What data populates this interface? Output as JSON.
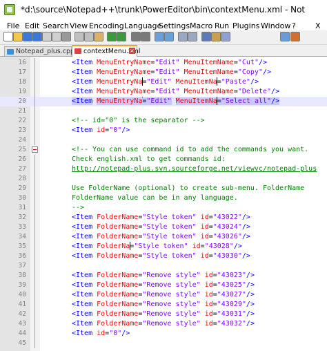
{
  "window": {
    "title": "*d:\\source\\Notepad++\\trunk\\PowerEditor\\bin\\contextMenu.xml - Not"
  },
  "menu": {
    "items": [
      "File",
      "Edit",
      "Search",
      "View",
      "Encoding",
      "Language",
      "Settings",
      "Macro",
      "Run",
      "Plugins",
      "Window",
      "?"
    ],
    "close_glyph": "X"
  },
  "toolbar": {
    "icons": [
      "new-file-icon",
      "open-file-icon",
      "save-icon",
      "save-all-icon",
      "close-file-icon",
      "close-all-icon",
      "print-icon",
      "cut-icon",
      "copy-icon",
      "paste-icon",
      "undo-icon",
      "redo-icon",
      "find-icon",
      "replace-icon",
      "zoom-in-icon",
      "zoom-out-icon",
      "sync-vertical-icon",
      "sync-horizontal-icon",
      "word-wrap-icon",
      "show-all-chars-icon",
      "indent-guide-icon",
      "user-lang-icon",
      "doc-map-icon"
    ]
  },
  "tabs": [
    {
      "label": "Notepad_plus.cpp",
      "active": false
    },
    {
      "label": "contextMenu.xml",
      "active": true
    }
  ],
  "editor": {
    "lines": [
      {
        "num": "16",
        "fold": "line",
        "tokens": [
          [
            "tag",
            "<Item "
          ],
          [
            "attr",
            "MenuEntryName"
          ],
          [
            "eq",
            "="
          ],
          [
            "val",
            "\"Edit\""
          ],
          [
            "attr",
            " MenuItemName"
          ],
          [
            "eq",
            "="
          ],
          [
            "val",
            "\"Cut\""
          ],
          [
            "tag",
            "/>"
          ]
        ]
      },
      {
        "num": "17",
        "fold": "line",
        "tokens": [
          [
            "tag",
            "<Item "
          ],
          [
            "attr",
            "MenuEntryName"
          ],
          [
            "eq",
            "="
          ],
          [
            "val",
            "\"Edit\""
          ],
          [
            "attr",
            " MenuItemName"
          ],
          [
            "eq",
            "="
          ],
          [
            "val",
            "\"Copy\""
          ],
          [
            "tag",
            "/>"
          ]
        ]
      },
      {
        "num": "18",
        "fold": "line",
        "tokens": [
          [
            "tag",
            "<Item "
          ],
          [
            "attr",
            "MenuEntryNa"
          ],
          [
            "caret",
            ""
          ],
          [
            "eq",
            "="
          ],
          [
            "val",
            "\"Edit\""
          ],
          [
            "attr",
            " MenuItemNa"
          ],
          [
            "caret",
            ""
          ],
          [
            "eq",
            "="
          ],
          [
            "val",
            "\"Paste\""
          ],
          [
            "tag",
            "/>"
          ]
        ]
      },
      {
        "num": "19",
        "fold": "line",
        "tokens": [
          [
            "tag",
            "<Item "
          ],
          [
            "attr",
            "MenuEntryName"
          ],
          [
            "eq",
            "="
          ],
          [
            "val",
            "\"Edit\""
          ],
          [
            "attr",
            " MenuItemName"
          ],
          [
            "eq",
            "="
          ],
          [
            "val",
            "\"Delete\""
          ],
          [
            "tag",
            "/>"
          ]
        ]
      },
      {
        "num": "20",
        "fold": "line",
        "current": true,
        "tokens": [
          [
            "tag-hl",
            "<Item"
          ],
          [
            "tag",
            " "
          ],
          [
            "attr-hl",
            "MenuEntryNa"
          ],
          [
            "caret",
            ""
          ],
          [
            "eq-hl",
            "="
          ],
          [
            "val-hl",
            "\"Edit\""
          ],
          [
            "attr",
            " "
          ],
          [
            "attr-hl",
            "MenuItemNa"
          ],
          [
            "caret",
            ""
          ],
          [
            "eq-hl",
            "="
          ],
          [
            "val-hl",
            "\"Select all\""
          ],
          [
            "tag-hl",
            "/>"
          ]
        ]
      },
      {
        "num": "21",
        "fold": "line",
        "tokens": []
      },
      {
        "num": "22",
        "fold": "line",
        "tokens": [
          [
            "com",
            "<!-- id=\"0\" is the separator -->"
          ]
        ]
      },
      {
        "num": "23",
        "fold": "line",
        "tokens": [
          [
            "tag",
            "<Item "
          ],
          [
            "attr",
            "id"
          ],
          [
            "eq",
            "="
          ],
          [
            "val",
            "\"0\""
          ],
          [
            "tag",
            "/>"
          ]
        ]
      },
      {
        "num": "24",
        "fold": "line",
        "tokens": []
      },
      {
        "num": "25",
        "fold": "box",
        "tokens": [
          [
            "com",
            "<!-- You can use command id to add the commands you want."
          ]
        ]
      },
      {
        "num": "26",
        "fold": "line",
        "tokens": [
          [
            "com",
            "Check english.xml to get commands id:"
          ]
        ]
      },
      {
        "num": "27",
        "fold": "line",
        "tokens": [
          [
            "link",
            "http://notepad-plus.svn.sourceforge.net/viewvc/notepad-plus"
          ]
        ]
      },
      {
        "num": "28",
        "fold": "line",
        "tokens": []
      },
      {
        "num": "29",
        "fold": "line",
        "tokens": [
          [
            "com",
            "Use FolderName (optional) to create sub-menu. FolderName"
          ]
        ]
      },
      {
        "num": "30",
        "fold": "line",
        "tokens": [
          [
            "com",
            "FolderName value can be in any language."
          ]
        ]
      },
      {
        "num": "31",
        "fold": "line",
        "tokens": [
          [
            "com",
            "-->"
          ]
        ]
      },
      {
        "num": "32",
        "fold": "line",
        "tokens": [
          [
            "tag",
            "<Item "
          ],
          [
            "attr",
            "FolderName"
          ],
          [
            "eq",
            "="
          ],
          [
            "val",
            "\"Style token\""
          ],
          [
            "attr",
            " id"
          ],
          [
            "eq",
            "="
          ],
          [
            "val",
            "\"43022\""
          ],
          [
            "tag",
            "/>"
          ]
        ]
      },
      {
        "num": "33",
        "fold": "line",
        "tokens": [
          [
            "tag",
            "<Item "
          ],
          [
            "attr",
            "FolderName"
          ],
          [
            "eq",
            "="
          ],
          [
            "val",
            "\"Style token\""
          ],
          [
            "attr",
            " id"
          ],
          [
            "eq",
            "="
          ],
          [
            "val",
            "\"43024\""
          ],
          [
            "tag",
            "/>"
          ]
        ]
      },
      {
        "num": "34",
        "fold": "line",
        "tokens": [
          [
            "tag",
            "<Item "
          ],
          [
            "attr",
            "FolderName"
          ],
          [
            "eq",
            "="
          ],
          [
            "val",
            "\"Style token\""
          ],
          [
            "attr",
            " id"
          ],
          [
            "eq",
            "="
          ],
          [
            "val",
            "\"43026\""
          ],
          [
            "tag",
            "/>"
          ]
        ]
      },
      {
        "num": "35",
        "fold": "line",
        "tokens": [
          [
            "tag",
            "<Item "
          ],
          [
            "attr",
            "FolderNa"
          ],
          [
            "caret",
            ""
          ],
          [
            "eq",
            "="
          ],
          [
            "val",
            "\"Style token\""
          ],
          [
            "attr",
            " id"
          ],
          [
            "eq",
            "="
          ],
          [
            "val",
            "\"43028\""
          ],
          [
            "tag",
            "/>"
          ]
        ]
      },
      {
        "num": "36",
        "fold": "line",
        "tokens": [
          [
            "tag",
            "<Item "
          ],
          [
            "attr",
            "FolderName"
          ],
          [
            "eq",
            "="
          ],
          [
            "val",
            "\"Style token\""
          ],
          [
            "attr",
            " id"
          ],
          [
            "eq",
            "="
          ],
          [
            "val",
            "\"43030\""
          ],
          [
            "tag",
            "/>"
          ]
        ]
      },
      {
        "num": "37",
        "fold": "line",
        "tokens": []
      },
      {
        "num": "38",
        "fold": "line",
        "tokens": [
          [
            "tag",
            "<Item "
          ],
          [
            "attr",
            "FolderName"
          ],
          [
            "eq",
            "="
          ],
          [
            "val",
            "\"Remove style\""
          ],
          [
            "attr",
            " id"
          ],
          [
            "eq",
            "="
          ],
          [
            "val",
            "\"43023\""
          ],
          [
            "tag",
            "/>"
          ]
        ]
      },
      {
        "num": "39",
        "fold": "line",
        "tokens": [
          [
            "tag",
            "<Item "
          ],
          [
            "attr",
            "FolderName"
          ],
          [
            "eq",
            "="
          ],
          [
            "val",
            "\"Remove style\""
          ],
          [
            "attr",
            " id"
          ],
          [
            "eq",
            "="
          ],
          [
            "val",
            "\"43025\""
          ],
          [
            "tag",
            "/>"
          ]
        ]
      },
      {
        "num": "40",
        "fold": "line",
        "tokens": [
          [
            "tag",
            "<Item "
          ],
          [
            "attr",
            "FolderName"
          ],
          [
            "eq",
            "="
          ],
          [
            "val",
            "\"Remove style\""
          ],
          [
            "attr",
            " id"
          ],
          [
            "eq",
            "="
          ],
          [
            "val",
            "\"43027\""
          ],
          [
            "tag",
            "/>"
          ]
        ]
      },
      {
        "num": "41",
        "fold": "line",
        "tokens": [
          [
            "tag",
            "<Item "
          ],
          [
            "attr",
            "FolderName"
          ],
          [
            "eq",
            "="
          ],
          [
            "val",
            "\"Remove style\""
          ],
          [
            "attr",
            " id"
          ],
          [
            "eq",
            "="
          ],
          [
            "val",
            "\"43029\""
          ],
          [
            "tag",
            "/>"
          ]
        ]
      },
      {
        "num": "42",
        "fold": "line",
        "tokens": [
          [
            "tag",
            "<Item "
          ],
          [
            "attr",
            "FolderName"
          ],
          [
            "eq",
            "="
          ],
          [
            "val",
            "\"Remove style\""
          ],
          [
            "attr",
            " id"
          ],
          [
            "eq",
            "="
          ],
          [
            "val",
            "\"43031\""
          ],
          [
            "tag",
            "/>"
          ]
        ]
      },
      {
        "num": "43",
        "fold": "line",
        "tokens": [
          [
            "tag",
            "<Item "
          ],
          [
            "attr",
            "FolderName"
          ],
          [
            "eq",
            "="
          ],
          [
            "val",
            "\"Remove style\""
          ],
          [
            "attr",
            " id"
          ],
          [
            "eq",
            "="
          ],
          [
            "val",
            "\"43032\""
          ],
          [
            "tag",
            "/>"
          ]
        ]
      },
      {
        "num": "44",
        "fold": "line",
        "tokens": [
          [
            "tag",
            "<Item "
          ],
          [
            "attr",
            "id"
          ],
          [
            "eq",
            "="
          ],
          [
            "val",
            "\"0\""
          ],
          [
            "tag",
            "/>"
          ]
        ]
      },
      {
        "num": "45",
        "fold": "line",
        "tokens": []
      }
    ]
  }
}
